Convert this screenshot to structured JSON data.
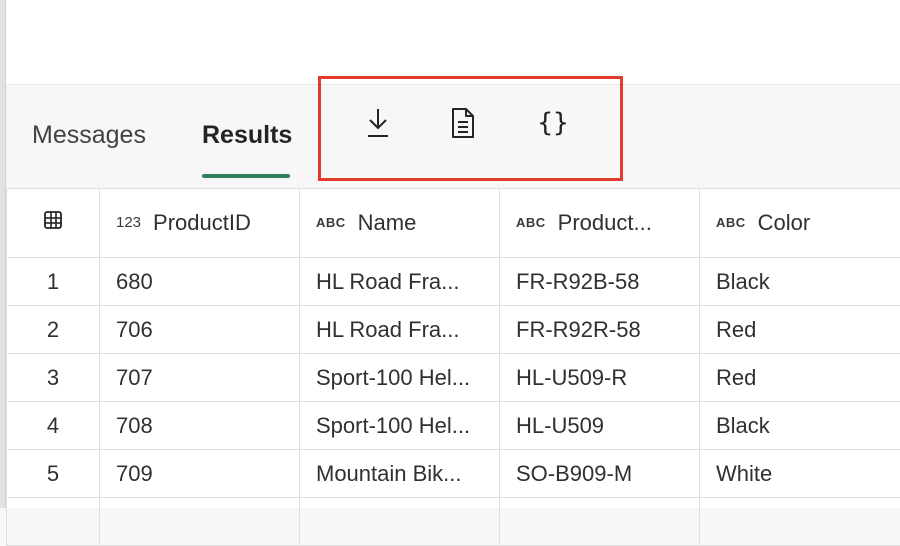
{
  "tabs": {
    "messages_label": "Messages",
    "results_label": "Results"
  },
  "toolbar": {
    "download_icon": "download-icon",
    "csv_icon": "document-icon",
    "json_label": "{}"
  },
  "colors": {
    "accent": "#2f7d5a",
    "highlight": "#e23b2e"
  },
  "grid": {
    "columns": [
      {
        "type": "123",
        "name": "ProductID"
      },
      {
        "type": "ABC",
        "name": "Name"
      },
      {
        "type": "ABC",
        "name": "Product..."
      },
      {
        "type": "ABC",
        "name": "Color"
      }
    ],
    "rows": [
      {
        "num": "1",
        "cells": [
          "680",
          "HL Road Fra...",
          "FR-R92B-58",
          "Black"
        ]
      },
      {
        "num": "2",
        "cells": [
          "706",
          "HL Road Fra...",
          "FR-R92R-58",
          "Red"
        ]
      },
      {
        "num": "3",
        "cells": [
          "707",
          "Sport-100 Hel...",
          "HL-U509-R",
          "Red"
        ]
      },
      {
        "num": "4",
        "cells": [
          "708",
          "Sport-100 Hel...",
          "HL-U509",
          "Black"
        ]
      },
      {
        "num": "5",
        "cells": [
          "709",
          "Mountain Bik...",
          "SO-B909-M",
          "White"
        ]
      }
    ]
  }
}
